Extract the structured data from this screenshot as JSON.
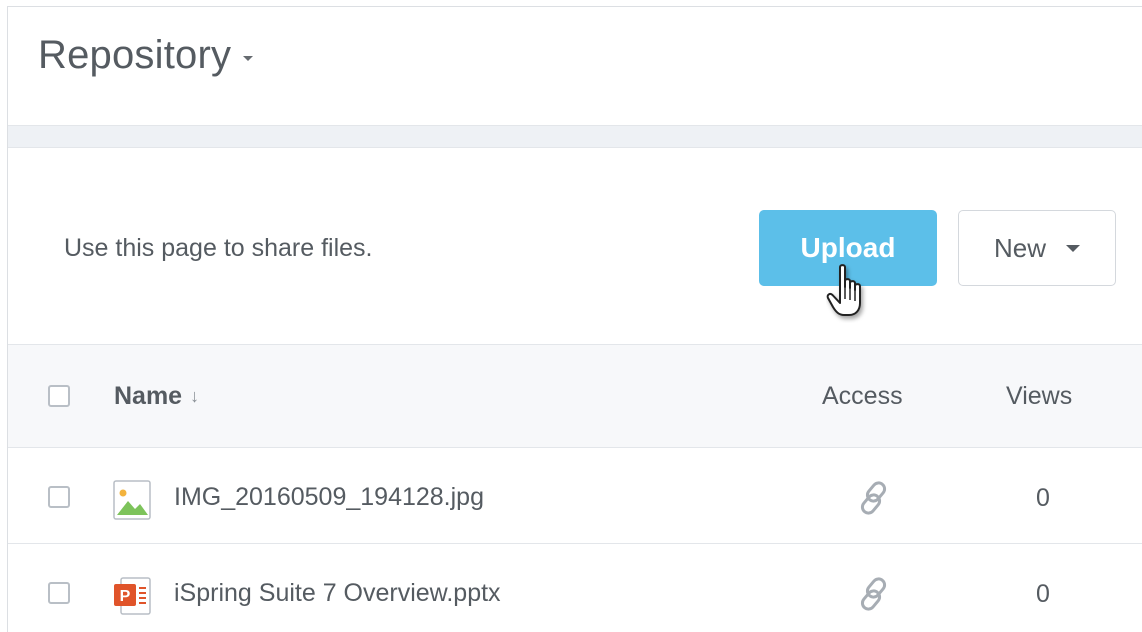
{
  "header": {
    "title": "Repository"
  },
  "action_bar": {
    "description": "Use this page to share files.",
    "upload_label": "Upload",
    "new_label": "New"
  },
  "table": {
    "columns": {
      "name": "Name",
      "name_sort_indicator": "↓",
      "access": "Access",
      "views": "Views"
    },
    "rows": [
      {
        "name": "IMG_20160509_194128.jpg",
        "file_type": "image-file-icon",
        "access": "link-icon",
        "views": "0"
      },
      {
        "name": "iSpring Suite 7 Overview.pptx",
        "file_type": "powerpoint-file-icon",
        "access": "link-icon",
        "views": "0"
      }
    ]
  },
  "colors": {
    "upload_button": "#5cbfe9",
    "table_header_bg": "#f7f8fa",
    "band_bg": "#eef1f5",
    "text": "#555b61",
    "pptx_icon": "#e0542a"
  }
}
